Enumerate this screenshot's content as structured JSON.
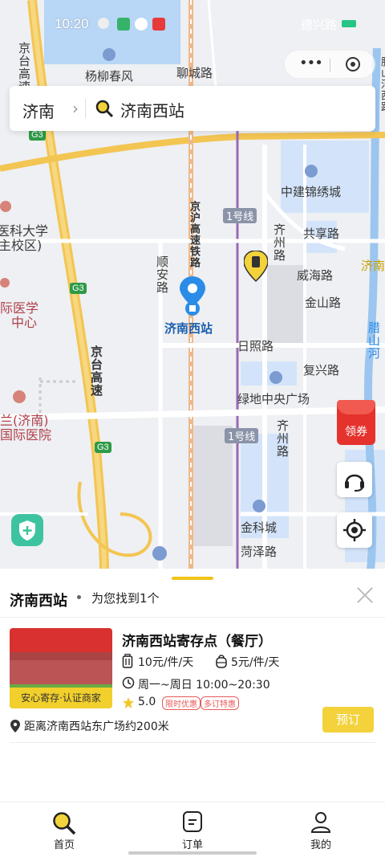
{
  "status": {
    "time": "10:20",
    "right_text": "德兴路"
  },
  "capsule": {
    "more_icon": "more-dots-icon",
    "close_icon": "target-icon"
  },
  "search": {
    "city": "济南",
    "keyword": "济南西站"
  },
  "map": {
    "labels": {
      "yangliu": "杨柳春风",
      "liaocheng": "聊城路",
      "jingtai_gaosu_top": "京台高速",
      "zhongjian": "中建锦绣城",
      "line1_top": "1号线",
      "gongxiang": "共享路",
      "qizhou_top": "齐州路",
      "weihai": "威海路",
      "jinan_right": "济南",
      "jinshan": "金山路",
      "shun_an": "顺安路",
      "jinghu": "京沪高速铁路",
      "station": "济南西站",
      "rizhao": "日照路",
      "fuxing": "复兴路",
      "lvdi": "绿地中央广场",
      "gutian": "腊山河",
      "yike1": "医科大学",
      "yike2": "主校区)",
      "yixue1": "际医学",
      "yixue2": "中心",
      "jingtai": "京台高速",
      "jinan_hosp1": "兰(济南)",
      "jinan_hosp2": "国际医院",
      "line1_bottom": "1号线",
      "qizhou_bottom": "齐州路",
      "jinke": "金科城",
      "heze": "菏泽路",
      "lishan_right": "腊山河西路"
    },
    "shields": [
      "G3",
      "G3",
      "G3"
    ],
    "red_packet": "领券"
  },
  "panel": {
    "title": "济南西站",
    "found_text": "为您找到1个",
    "store": {
      "name": "济南西站寄存点（餐厅）",
      "badge": "安心寄存·认证商家",
      "price_large": "10元/件/天",
      "price_small": "5元/件/天",
      "hours": "周一~周日 10:00~20:30",
      "rating": "5.0",
      "tags": [
        "限时优惠",
        "多订特惠"
      ],
      "distance": "距离济南西站东广场约200米",
      "book_label": "预订"
    }
  },
  "tabs": [
    {
      "label": "首页",
      "icon": "search-icon"
    },
    {
      "label": "订单",
      "icon": "order-icon"
    },
    {
      "label": "我的",
      "icon": "user-icon"
    }
  ],
  "colors": {
    "accent": "#F3D23B",
    "badge": "#F1CF2C",
    "tag_red": "#E85A5A",
    "marker_blue": "#2B8CE8"
  }
}
